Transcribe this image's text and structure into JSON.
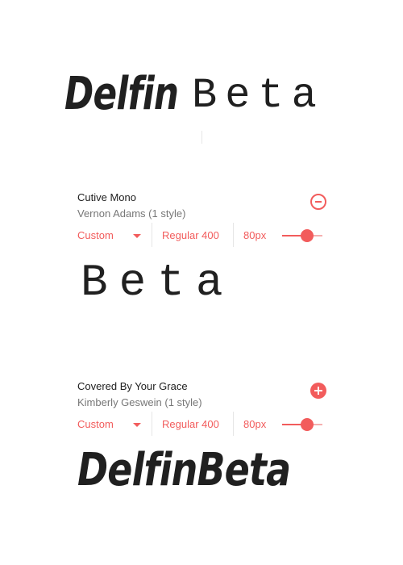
{
  "pairing_preview": {
    "first_word": "Delfin",
    "second_word": "Beta"
  },
  "fonts": [
    {
      "name": "Cutive Mono",
      "author": "Vernon Adams (1 style)",
      "toggle_icon": "minus-circle-icon",
      "variant": "Custom",
      "weight": "Regular 400",
      "size": "80px",
      "slider_level": 0.62,
      "sample_text": "Beta"
    },
    {
      "name": "Covered By Your Grace",
      "author": "Kimberly Geswein (1 style)",
      "toggle_icon": "plus-circle-icon",
      "variant": "Custom",
      "weight": "Regular 400",
      "size": "80px",
      "slider_level": 0.62,
      "sample_text": "DelfinBeta"
    }
  ],
  "colors": {
    "accent": "#f25c5c",
    "text": "#212121",
    "muted": "#777777",
    "divider": "#e6e6e6"
  }
}
